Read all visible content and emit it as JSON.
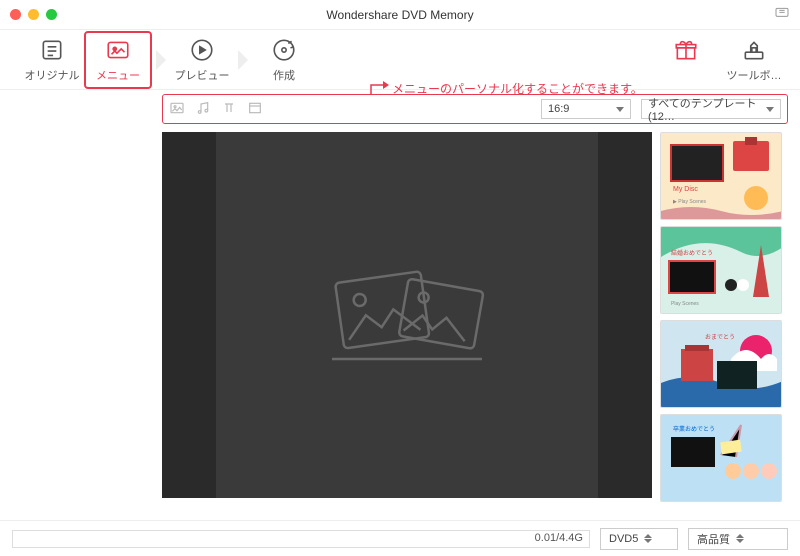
{
  "window": {
    "title": "Wondershare DVD Memory"
  },
  "toolbar": {
    "original": "オリジナル",
    "menu": "メニュー",
    "preview": "プレビュー",
    "create": "作成",
    "toolbox": "ツールボ…"
  },
  "annotation": {
    "text": "メニューのパーソナル化することができます。"
  },
  "subbar": {
    "aspect": "16:9",
    "templates": "すべてのテンプレート(12…"
  },
  "footer": {
    "progress": "0.01/4.4G",
    "disc": "DVD5",
    "quality": "高品質"
  }
}
